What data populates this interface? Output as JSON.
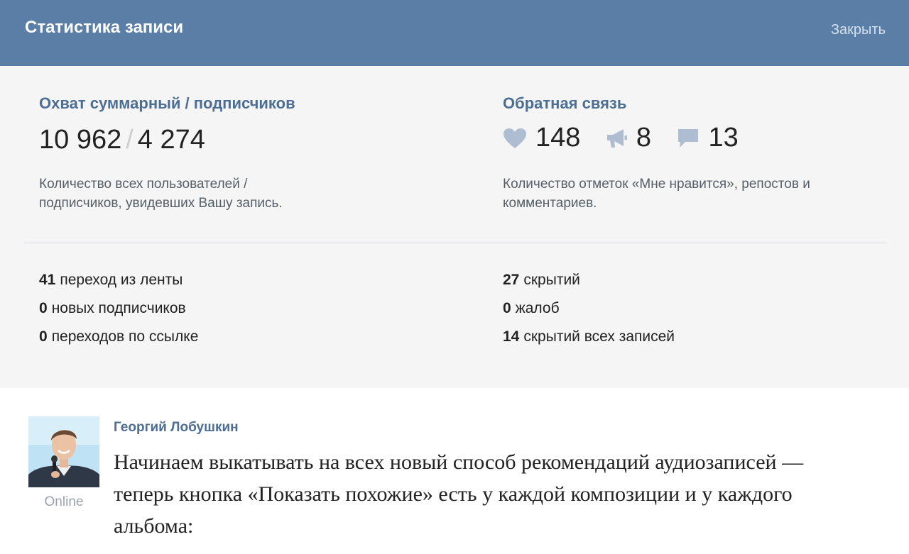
{
  "header": {
    "title": "Статистика записи",
    "close_label": "Закрыть"
  },
  "reach": {
    "title": "Охват суммарный / подписчиков",
    "total": "10 962",
    "separator": "/",
    "subscribers": "4 274",
    "description": "Количество всех пользователей / подписчиков, увидевших Вашу запись."
  },
  "feedback": {
    "title": "Обратная связь",
    "likes": "148",
    "reposts": "8",
    "comments": "13",
    "description": "Количество отметок «Мне нравится», репостов и комментариев.",
    "icon_color": "#aebdd1"
  },
  "left_stats": [
    {
      "value": "41",
      "label": "переход из ленты"
    },
    {
      "value": "0",
      "label": "новых подписчиков"
    },
    {
      "value": "0",
      "label": "переходов по ссылке"
    }
  ],
  "right_stats": [
    {
      "value": "27",
      "label": "скрытий"
    },
    {
      "value": "0",
      "label": "жалоб"
    },
    {
      "value": "14",
      "label": "скрытий всех записей"
    }
  ],
  "post": {
    "author": "Георгий Лобушкин",
    "status": "Online",
    "text": "Начинаем выкатывать на всех новый способ рекомендаций аудиозаписей — теперь кнопка «Показать похожие» есть у каждой композиции и у каждого альбома:"
  },
  "colors": {
    "header_bg": "#5b7ea6",
    "accent": "#4d6e93",
    "stats_bg": "#f5f5f5"
  }
}
